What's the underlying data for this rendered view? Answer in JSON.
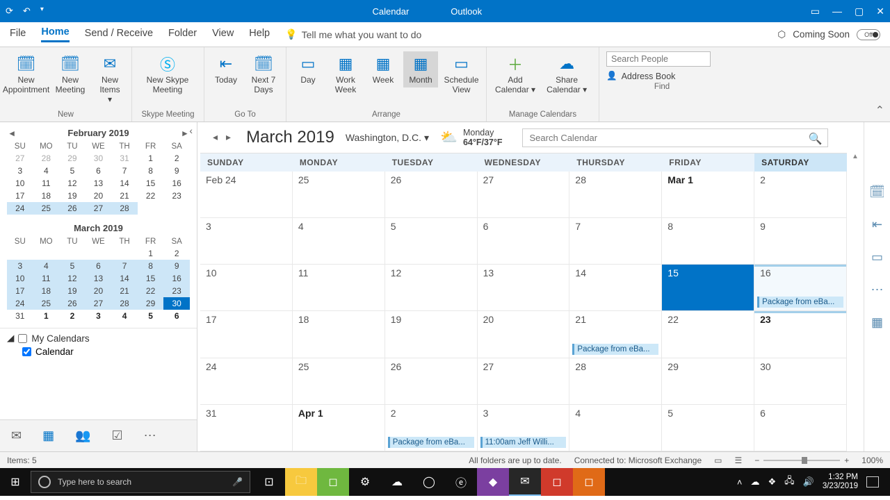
{
  "title_bar": {
    "app_section": "Calendar",
    "app_name": "Outlook"
  },
  "menu": {
    "tabs": [
      "File",
      "Home",
      "Send / Receive",
      "Folder",
      "View",
      "Help"
    ],
    "active": "Home",
    "tell_me": "Tell me what you want to do",
    "coming_soon": "Coming Soon",
    "toggle_label": "Off"
  },
  "ribbon": {
    "groups": [
      {
        "label": "New",
        "buttons": [
          {
            "label": "New\nAppointment"
          },
          {
            "label": "New\nMeeting"
          },
          {
            "label": "New\nItems ▾"
          }
        ]
      },
      {
        "label": "Skype Meeting",
        "buttons": [
          {
            "label": "New Skype\nMeeting"
          }
        ]
      },
      {
        "label": "Go To",
        "buttons": [
          {
            "label": "Today"
          },
          {
            "label": "Next 7\nDays"
          }
        ]
      },
      {
        "label": "Arrange",
        "buttons": [
          {
            "label": "Day"
          },
          {
            "label": "Work\nWeek"
          },
          {
            "label": "Week"
          },
          {
            "label": "Month",
            "selected": true
          },
          {
            "label": "Schedule\nView"
          }
        ]
      },
      {
        "label": "Manage Calendars",
        "buttons": [
          {
            "label": "Add\nCalendar ▾"
          },
          {
            "label": "Share\nCalendar ▾"
          }
        ]
      },
      {
        "label": "Find"
      }
    ],
    "search_people_placeholder": "Search People",
    "address_book": "Address Book"
  },
  "mini_cals": {
    "dow": [
      "SU",
      "MO",
      "TU",
      "WE",
      "TH",
      "FR",
      "SA"
    ],
    "feb": {
      "title": "February 2019",
      "rows": [
        [
          "27",
          "28",
          "29",
          "30",
          "31",
          "1",
          "2"
        ],
        [
          "3",
          "4",
          "5",
          "6",
          "7",
          "8",
          "9"
        ],
        [
          "10",
          "11",
          "12",
          "13",
          "14",
          "15",
          "16"
        ],
        [
          "17",
          "18",
          "19",
          "20",
          "21",
          "22",
          "23"
        ],
        [
          "24",
          "25",
          "26",
          "27",
          "28",
          "",
          ""
        ]
      ]
    },
    "mar": {
      "title": "March 2019",
      "rows": [
        [
          "",
          "",
          "",
          "",
          "",
          "1",
          "2"
        ],
        [
          "3",
          "4",
          "5",
          "6",
          "7",
          "8",
          "9"
        ],
        [
          "10",
          "11",
          "12",
          "13",
          "14",
          "15",
          "16"
        ],
        [
          "17",
          "18",
          "19",
          "20",
          "21",
          "22",
          "23"
        ],
        [
          "24",
          "25",
          "26",
          "27",
          "28",
          "29",
          "30"
        ],
        [
          "31",
          "1",
          "2",
          "3",
          "4",
          "5",
          "6"
        ]
      ]
    }
  },
  "my_calendars": {
    "title": "My Calendars",
    "items": [
      "Calendar"
    ]
  },
  "cal_header": {
    "month": "March 2019",
    "location": "Washington,  D.C.",
    "weather_day": "Monday",
    "weather_temp": "64°F/37°F",
    "search_placeholder": "Search Calendar"
  },
  "cal_grid": {
    "days": [
      "SUNDAY",
      "MONDAY",
      "TUESDAY",
      "WEDNESDAY",
      "THURSDAY",
      "FRIDAY",
      "SATURDAY"
    ],
    "cells": [
      [
        "Feb 24",
        "25",
        "26",
        "27",
        "28",
        "Mar 1",
        "2"
      ],
      [
        "3",
        "4",
        "5",
        "6",
        "7",
        "8",
        "9"
      ],
      [
        "10",
        "11",
        "12",
        "13",
        "14",
        "15",
        "16"
      ],
      [
        "17",
        "18",
        "19",
        "20",
        "21",
        "22",
        "23"
      ],
      [
        "24",
        "25",
        "26",
        "27",
        "28",
        "29",
        "30"
      ],
      [
        "31",
        "Apr 1",
        "2",
        "3",
        "4",
        "5",
        "6"
      ]
    ],
    "events": {
      "r2c6": "Package from eBa...",
      "r3c4": "Package from eBa...",
      "r5c2": "Package from eBa...",
      "r5c3": "11:00am Jeff Willi..."
    }
  },
  "status": {
    "items": "Items: 5",
    "sync": "All folders are up to date.",
    "conn": "Connected to: Microsoft Exchange",
    "zoom": "100%"
  },
  "taskbar": {
    "search_placeholder": "Type here to search",
    "time": "1:32 PM",
    "date": "3/23/2019"
  }
}
